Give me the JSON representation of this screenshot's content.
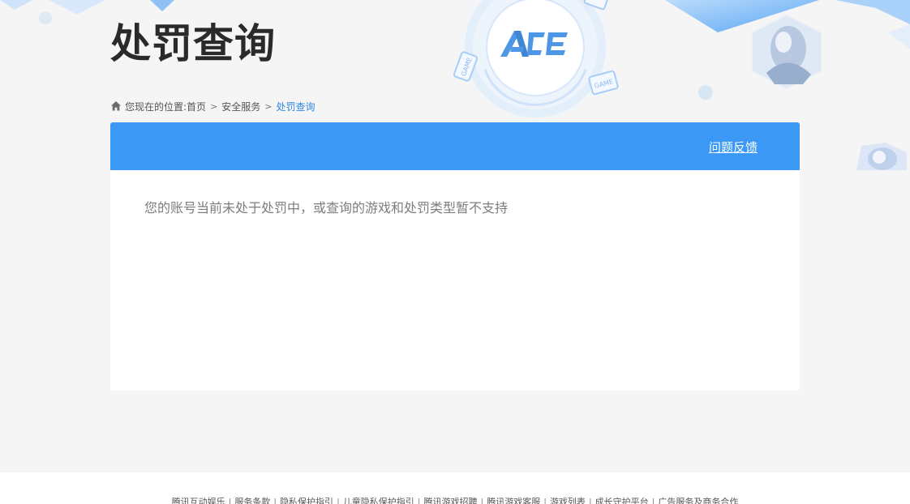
{
  "header": {
    "title": "处罚查询",
    "logo_text": "ACE",
    "deco_tags": [
      "GAME",
      "GAME"
    ]
  },
  "breadcrumb": {
    "prefix": "您现在的位置:",
    "items": [
      {
        "label": "首页"
      },
      {
        "label": "安全服务"
      }
    ],
    "separator": ">",
    "current": "处罚查询"
  },
  "panel": {
    "feedback_label": "问题反馈",
    "message": "您的账号当前未处于处罚中，或查询的游戏和处罚类型暂不支持"
  },
  "footer": {
    "links": [
      {
        "label": "腾讯互动娱乐"
      },
      {
        "label": "服务条款"
      },
      {
        "label": "隐私保护指引"
      },
      {
        "label": "儿童隐私保护指引"
      },
      {
        "label": "腾讯游戏招聘"
      },
      {
        "label": "腾讯游戏客服"
      },
      {
        "label": "游戏列表"
      },
      {
        "label": "成长守护平台"
      },
      {
        "label": "广告服务及商务合作"
      }
    ],
    "divider": "|"
  },
  "colors": {
    "accent": "#3c98f5",
    "current_crumb": "#2f88e0",
    "background": "#f5f5f6"
  }
}
